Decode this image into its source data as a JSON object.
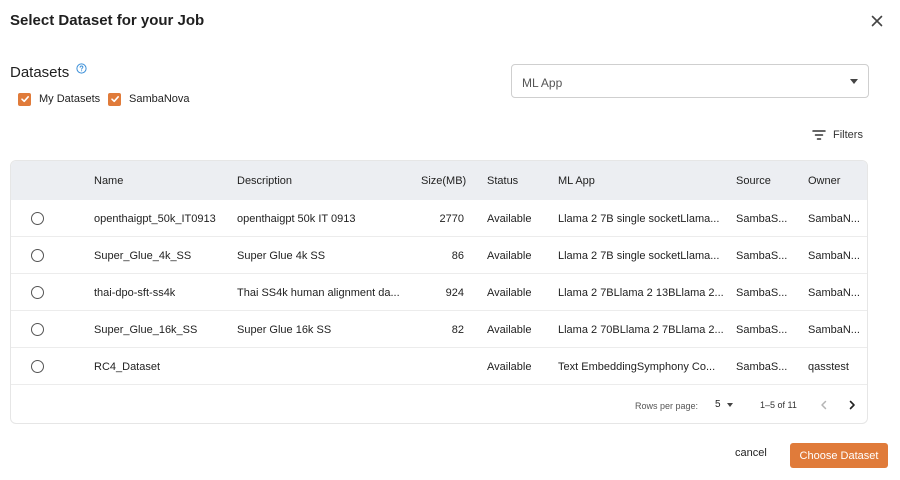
{
  "dialog": {
    "title": "Select Dataset for your Job"
  },
  "datasets": {
    "label": "Datasets",
    "checkboxes": [
      {
        "label": "My Datasets",
        "checked": true
      },
      {
        "label": "SambaNova",
        "checked": true
      }
    ]
  },
  "ml_app_select": {
    "value": "ML App"
  },
  "filters": {
    "label": "Filters"
  },
  "table": {
    "columns": [
      "Name",
      "Description",
      "Size(MB)",
      "Status",
      "ML App",
      "Source",
      "Owner"
    ],
    "rows": [
      {
        "name": "openthaigpt_50k_IT0913",
        "description": "openthaigpt 50k IT 0913",
        "size": "2770",
        "status": "Available",
        "ml_app": "Llama 2 7B single socketLlama...",
        "source": "SambaS...",
        "owner": "SambaN..."
      },
      {
        "name": "Super_Glue_4k_SS",
        "description": "Super Glue 4k SS",
        "size": "86",
        "status": "Available",
        "ml_app": "Llama 2 7B single socketLlama...",
        "source": "SambaS...",
        "owner": "SambaN..."
      },
      {
        "name": "thai-dpo-sft-ss4k",
        "description": "Thai SS4k human alignment da...",
        "size": "924",
        "status": "Available",
        "ml_app": "Llama 2 7BLlama 2 13BLlama 2...",
        "source": "SambaS...",
        "owner": "SambaN..."
      },
      {
        "name": "Super_Glue_16k_SS",
        "description": "Super Glue 16k SS",
        "size": "82",
        "status": "Available",
        "ml_app": "Llama 2 70BLlama 2 7BLlama 2...",
        "source": "SambaS...",
        "owner": "SambaN..."
      },
      {
        "name": "RC4_Dataset",
        "description": "",
        "size": "",
        "status": "Available",
        "ml_app": "Text EmbeddingSymphony Co...",
        "source": "SambaS...",
        "owner": "qasstest"
      }
    ]
  },
  "pagination": {
    "rows_per_page_label": "Rows per page:",
    "rows_per_page_value": "5",
    "range": "1–5 of 11"
  },
  "actions": {
    "cancel_label": "cancel",
    "choose_label": "Choose Dataset"
  },
  "colors": {
    "accent": "#e07b3a",
    "header_bg": "#eceef2",
    "help": "#3b8fd8"
  },
  "icons": {
    "close": "close-icon",
    "help": "help-circle-icon",
    "check": "checkmark-icon",
    "filter": "filter-lines-icon",
    "caret": "caret-down-icon",
    "prev": "chevron-left-icon",
    "next": "chevron-right-icon"
  }
}
